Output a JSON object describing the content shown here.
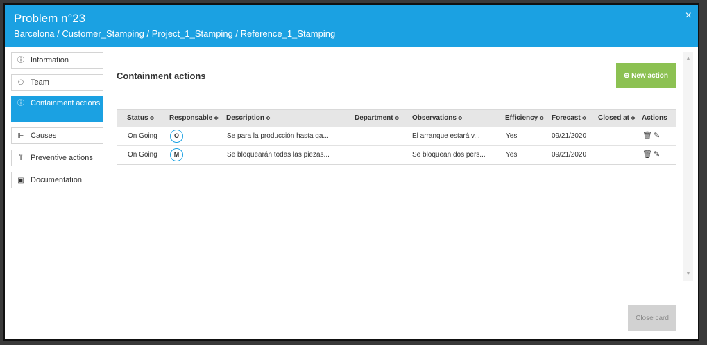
{
  "modal": {
    "title": "Problem n°23",
    "breadcrumb": "Barcelona / Customer_Stamping / Project_1_Stamping / Reference_1_Stamping",
    "close_glyph": "×"
  },
  "sidebar": {
    "items": [
      {
        "label": "Information",
        "icon": "info-icon",
        "glyph": "ⓘ",
        "active": false
      },
      {
        "label": "Team",
        "icon": "team-icon",
        "glyph": "⚇",
        "active": false
      },
      {
        "label": "Containment actions",
        "icon": "info-icon",
        "glyph": "ⓘ",
        "active": true
      },
      {
        "label": "Causes",
        "icon": "hierarchy-icon",
        "glyph": "⊩",
        "active": false
      },
      {
        "label": "Preventive actions",
        "icon": "flask-icon",
        "glyph": "ⴶ",
        "active": false
      },
      {
        "label": "Documentation",
        "icon": "document-icon",
        "glyph": "▣",
        "active": false
      }
    ]
  },
  "main": {
    "section_title": "Containment actions",
    "new_action_label": "⊕ New action",
    "table": {
      "headers": [
        "Status",
        "Responsable",
        "Description",
        "Department",
        "Observations",
        "Efficiency",
        "Forecast",
        "Closed at",
        "Actions"
      ],
      "sort_glyph": "≎",
      "rows": [
        {
          "status": "On Going",
          "responsable": "O",
          "description": "Se para la producción hasta ga...",
          "department": "",
          "observations": "El arranque estará v...",
          "efficiency": "Yes",
          "forecast": "09/21/2020",
          "closed_at": ""
        },
        {
          "status": "On Going",
          "responsable": "M",
          "description": "Se bloquearán todas las piezas...",
          "department": "",
          "observations": "Se bloquean dos pers...",
          "efficiency": "Yes",
          "forecast": "09/21/2020",
          "closed_at": ""
        }
      ],
      "delete_glyph": "🗑",
      "edit_glyph": "✎"
    }
  },
  "footer": {
    "close_card_label": "Close card"
  },
  "scrollbar": {
    "up": "▲",
    "down": "▼"
  },
  "colors": {
    "accent": "#1ba1e2",
    "new_action": "#8cc152",
    "close_card": "#d2d2d2"
  }
}
